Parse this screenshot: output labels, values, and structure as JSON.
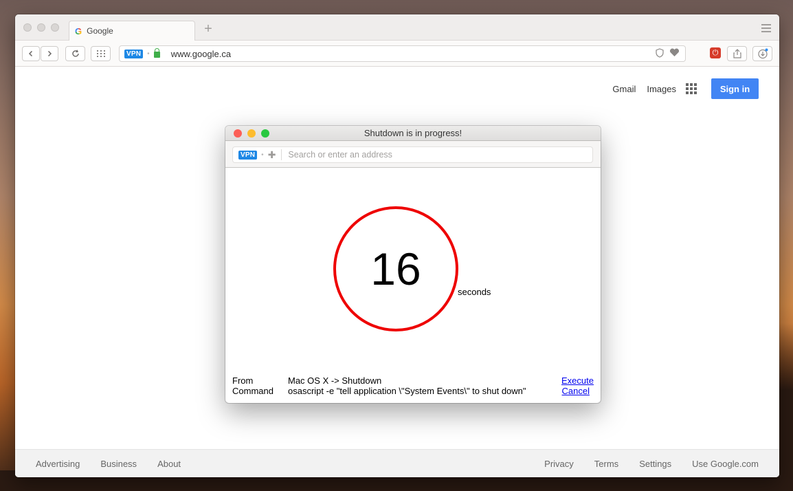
{
  "browser": {
    "tab_title": "Google",
    "tab_favicon": "G",
    "url": "www.google.ca",
    "vpn_label": "VPN"
  },
  "google": {
    "nav": {
      "gmail": "Gmail",
      "images": "Images",
      "signin": "Sign in"
    },
    "footer": {
      "left": [
        "Advertising",
        "Business",
        "About"
      ],
      "right": [
        "Privacy",
        "Terms",
        "Settings",
        "Use Google.com"
      ]
    }
  },
  "dialog": {
    "title": "Shutdown is in progress!",
    "vpn_label": "VPN",
    "search_placeholder": "Search or enter an address",
    "countdown_value": "16",
    "countdown_unit": "seconds",
    "from_label": "From",
    "from_value": "Mac OS X -> Shutdown",
    "command_label": "Command",
    "command_value": "osascript -e \"tell application \\\"System Events\\\" to shut down\"",
    "execute_label": "Execute",
    "cancel_label": "Cancel"
  },
  "colors": {
    "countdown_ring": "#ee0000",
    "signin_button": "#4285f4",
    "vpn_badge": "#1e88e5",
    "link": "#0000ee",
    "close_light": "#fc5f57",
    "minimize_light": "#fdbc2e",
    "zoom_light": "#28c840"
  }
}
